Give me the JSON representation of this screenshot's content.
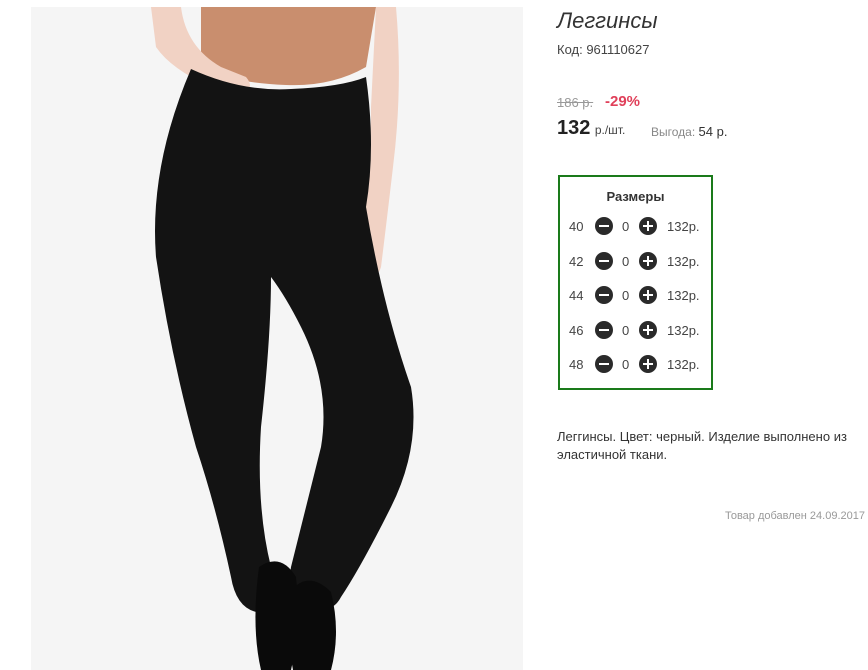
{
  "product": {
    "title": "Леггинсы",
    "code": "Код: 961110627",
    "old_price": "186 р.",
    "discount": "-29%",
    "price": "132",
    "price_unit": "р./шт.",
    "profit_label": "Выгода:",
    "profit_value": "54 р.",
    "description": "Леггинсы. Цвет: черный. Изделие выполнено из эластичной ткани.",
    "added": "Товар добавлен 24.09.2017"
  },
  "sizes": {
    "title": "Размеры",
    "rows": [
      {
        "size": "40",
        "qty": "0",
        "price": "132р."
      },
      {
        "size": "42",
        "qty": "0",
        "price": "132р."
      },
      {
        "size": "44",
        "qty": "0",
        "price": "132р."
      },
      {
        "size": "46",
        "qty": "0",
        "price": "132р."
      },
      {
        "size": "48",
        "qty": "0",
        "price": "132р."
      }
    ]
  },
  "icons": {
    "minus": "minus-circle-icon",
    "plus": "plus-circle-icon"
  },
  "colors": {
    "accent_discount": "#e0405a",
    "sizes_border": "#1a7a1a"
  }
}
